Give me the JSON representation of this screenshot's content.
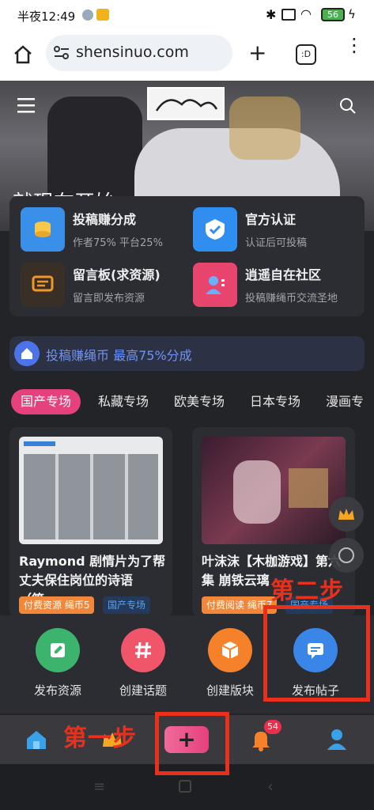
{
  "status": {
    "time": "半夜12:49",
    "battery": "56"
  },
  "browser": {
    "url": "shensinuo.com",
    "tab_label": ":D"
  },
  "hero": {
    "partial_text": "就现在开始"
  },
  "features": [
    {
      "title": "投稿赚分成",
      "subtitle": "作者75% 平台25%",
      "icon": "coins-icon",
      "color": "#3a8fe8"
    },
    {
      "title": "官方认证",
      "subtitle": "认证后可投稿",
      "icon": "verified-shield-icon",
      "color": "#2f8ef0"
    },
    {
      "title": "留言板(求资源)",
      "subtitle": "留言即发布资源",
      "icon": "message-board-icon",
      "color": "#3a2f26"
    },
    {
      "title": "逍遥自在社区",
      "subtitle": "投稿赚绳币交流圣地",
      "icon": "community-icon",
      "color": "#e8456e"
    }
  ],
  "promo": {
    "text": "投稿赚绳币 最高75%分成"
  },
  "tabs": [
    "国产专场",
    "私藏专场",
    "欧美专场",
    "日本专场",
    "漫画专"
  ],
  "cards": [
    {
      "title": "Raymond 剧情片为了帮丈夫保住岗位的诗语（第…",
      "badge_paid": "付费资源 绳币5",
      "badge_cat": "国产专场"
    },
    {
      "title": "叶沫沫【木枷游戏】第六集 崩铁云璃",
      "badge_paid": "付费阅读 绳币7",
      "badge_cat": "国产专场"
    }
  ],
  "actions": [
    {
      "label": "发布资源",
      "color": "#3db46d"
    },
    {
      "label": "创建话题",
      "color": "#f0556a"
    },
    {
      "label": "创建版块",
      "color": "#f5822a"
    },
    {
      "label": "发布帖子",
      "color": "#3a86e8"
    }
  ],
  "nav": {
    "badge_count": "54"
  },
  "annotations": {
    "step1": "第一步",
    "step2": "第二步"
  },
  "colors": {
    "accent_pink": "#e5417d",
    "annotation_red": "#e8301c",
    "background": "#232428"
  }
}
